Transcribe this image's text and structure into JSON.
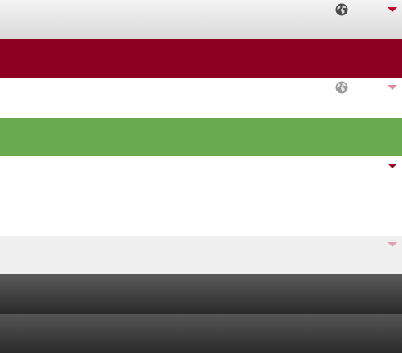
{
  "toolbars": [
    {
      "name": "header-bar-light",
      "color": "#e6e6e6"
    },
    {
      "name": "header-bar-maroon",
      "color": "#8d0022"
    },
    {
      "name": "header-bar-white",
      "color": "#ffffff"
    },
    {
      "name": "header-bar-green",
      "color": "#6aaa4f"
    },
    {
      "name": "content-panel-white",
      "color": "#ffffff"
    },
    {
      "name": "header-bar-light-gray",
      "color": "#f0f0f0"
    },
    {
      "name": "header-bar-dark-1",
      "color": "#3f3f3f"
    },
    {
      "name": "header-bar-dark-2",
      "color": "#3c3c3c"
    }
  ],
  "icons": {
    "globe": "globe-icon",
    "dropdown": "chevron-down-icon"
  },
  "accent_colors": {
    "caret_red": "#c4002b",
    "caret_pink": "#e08aa0",
    "caret_dark_red": "#9b0a2d"
  }
}
